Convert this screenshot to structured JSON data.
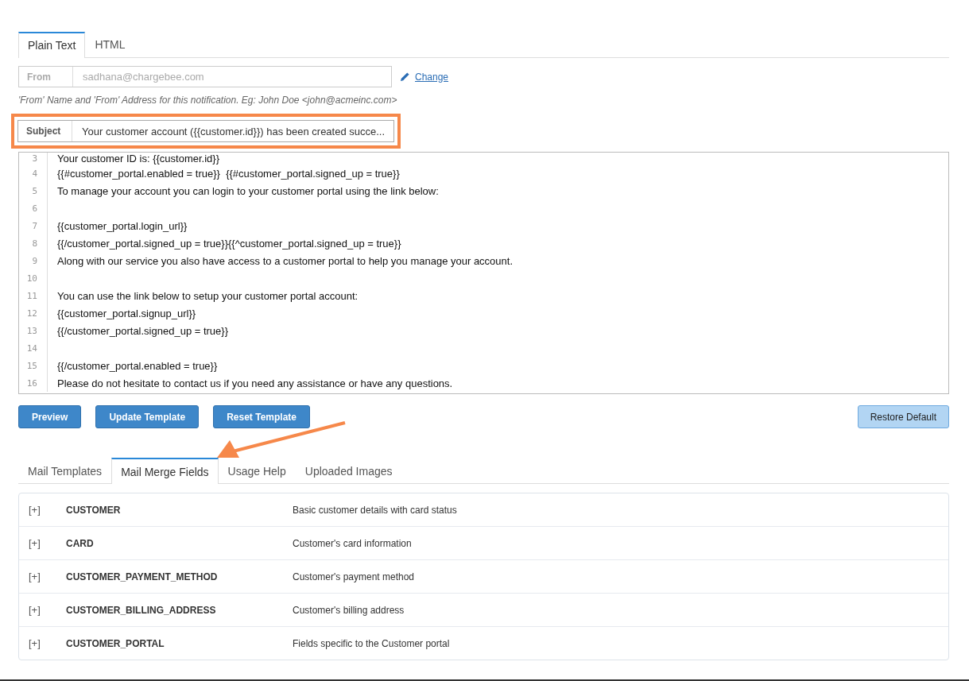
{
  "format_tabs": [
    {
      "label": "Plain Text",
      "selected": true
    },
    {
      "label": "HTML",
      "selected": false
    }
  ],
  "from": {
    "label": "From",
    "placeholder": "sadhana@chargebee.com",
    "change_link": "Change",
    "hint": "'From' Name and 'From' Address for this notification. Eg: John Doe <john@acmeinc.com>"
  },
  "subject": {
    "label": "Subject",
    "value": "Your customer account ({{customer.id}}) has been created succe...",
    "highlighted": true
  },
  "editor_lines": [
    {
      "number": "3",
      "text": "Your customer ID is: {{customer.id}}"
    },
    {
      "number": "4",
      "text": "{{#customer_portal.enabled = true}}  {{#customer_portal.signed_up = true}}"
    },
    {
      "number": "5",
      "text": "To manage your account you can login to your customer portal using the link below:"
    },
    {
      "number": "6"
    },
    {
      "number": "7",
      "text": "{{customer_portal.login_url}}"
    },
    {
      "number": "8",
      "text": "{{/customer_portal.signed_up = true}}{{^customer_portal.signed_up = true}}"
    },
    {
      "number": "9",
      "text": "Along with our service you also have access to a customer portal to help you manage your account."
    },
    {
      "number": "10"
    },
    {
      "number": "11",
      "text": "You can use the link below to setup your customer portal account:"
    },
    {
      "number": "12",
      "text": "{{customer_portal.signup_url}}"
    },
    {
      "number": "13",
      "text": "{{/customer_portal.signed_up = true}}"
    },
    {
      "number": "14"
    },
    {
      "number": "15",
      "text": "{{/customer_portal.enabled = true}}"
    },
    {
      "number": "16",
      "text": "Please do not hesitate to contact us if you need any assistance or have any questions."
    }
  ],
  "buttons": [
    {
      "label": "Preview",
      "kind": "primary"
    },
    {
      "label": "Update Template",
      "kind": "primary"
    },
    {
      "label": "Reset Template",
      "kind": "primary"
    },
    {
      "label": "Restore Default",
      "kind": "secondary"
    }
  ],
  "bottom_tabs": [
    {
      "label": "Mail Templates",
      "selected": false
    },
    {
      "label": "Mail Merge Fields",
      "selected": true
    },
    {
      "label": "Usage Help",
      "selected": false
    },
    {
      "label": "Uploaded Images",
      "selected": false
    }
  ],
  "merge_fields": [
    {
      "toggle": "[+]",
      "name": "CUSTOMER",
      "description": "Basic customer details with card status"
    },
    {
      "toggle": "[+]",
      "name": "CARD",
      "description": "Customer's card information"
    },
    {
      "toggle": "[+]",
      "name": "CUSTOMER_PAYMENT_METHOD",
      "description": "Customer's payment method"
    },
    {
      "toggle": "[+]",
      "name": "CUSTOMER_BILLING_ADDRESS",
      "description": "Customer's billing address"
    },
    {
      "toggle": "[+]",
      "name": "CUSTOMER_PORTAL",
      "description": "Fields specific to the Customer portal"
    }
  ]
}
